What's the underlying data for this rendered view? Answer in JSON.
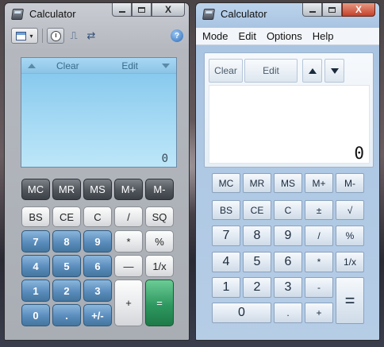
{
  "window1": {
    "title": "Calculator",
    "close_glyph": "X",
    "toolbar": {
      "view_dropdown_glyph": "▾",
      "graph_glyph": "⎍",
      "swap_glyph": "⇄",
      "help_glyph": "?"
    },
    "display": {
      "clear_label": "Clear",
      "edit_label": "Edit",
      "value": "0"
    },
    "memory_keys": [
      "MC",
      "MR",
      "MS",
      "M+",
      "M-"
    ],
    "keys": {
      "bs": "BS",
      "ce": "CE",
      "c": "C",
      "div": "/",
      "sq": "SQ",
      "seven": "7",
      "eight": "8",
      "nine": "9",
      "mul": "*",
      "pct": "%",
      "four": "4",
      "five": "5",
      "six": "6",
      "minus": "—",
      "inv": "1/x",
      "one": "1",
      "two": "2",
      "three": "3",
      "plus": "+",
      "eq": "=",
      "zero": "0",
      "dot": ".",
      "sign": "+/-"
    }
  },
  "window2": {
    "title": "Calculator",
    "close_glyph": "X",
    "menu": [
      "Mode",
      "Edit",
      "Options",
      "Help"
    ],
    "history": {
      "clear_label": "Clear",
      "edit_label": "Edit"
    },
    "display": {
      "value": "0"
    },
    "keys": {
      "mc": "MC",
      "mr": "MR",
      "ms": "MS",
      "mplus": "M+",
      "mminus": "M-",
      "bs": "BS",
      "ce": "CE",
      "c": "C",
      "sign": "±",
      "sqrt": "√",
      "seven": "7",
      "eight": "8",
      "nine": "9",
      "div": "/",
      "pct": "%",
      "four": "4",
      "five": "5",
      "six": "6",
      "mul": "*",
      "inv": "1/x",
      "one": "1",
      "two": "2",
      "three": "3",
      "minus": "-",
      "eq": "=",
      "zero": "0",
      "dot": ".",
      "plus": "+"
    }
  },
  "colors": {
    "equals_key_window1": "#2e9860",
    "number_key_window1": "#5a8cbc",
    "display_window1": "#a6daf4"
  }
}
